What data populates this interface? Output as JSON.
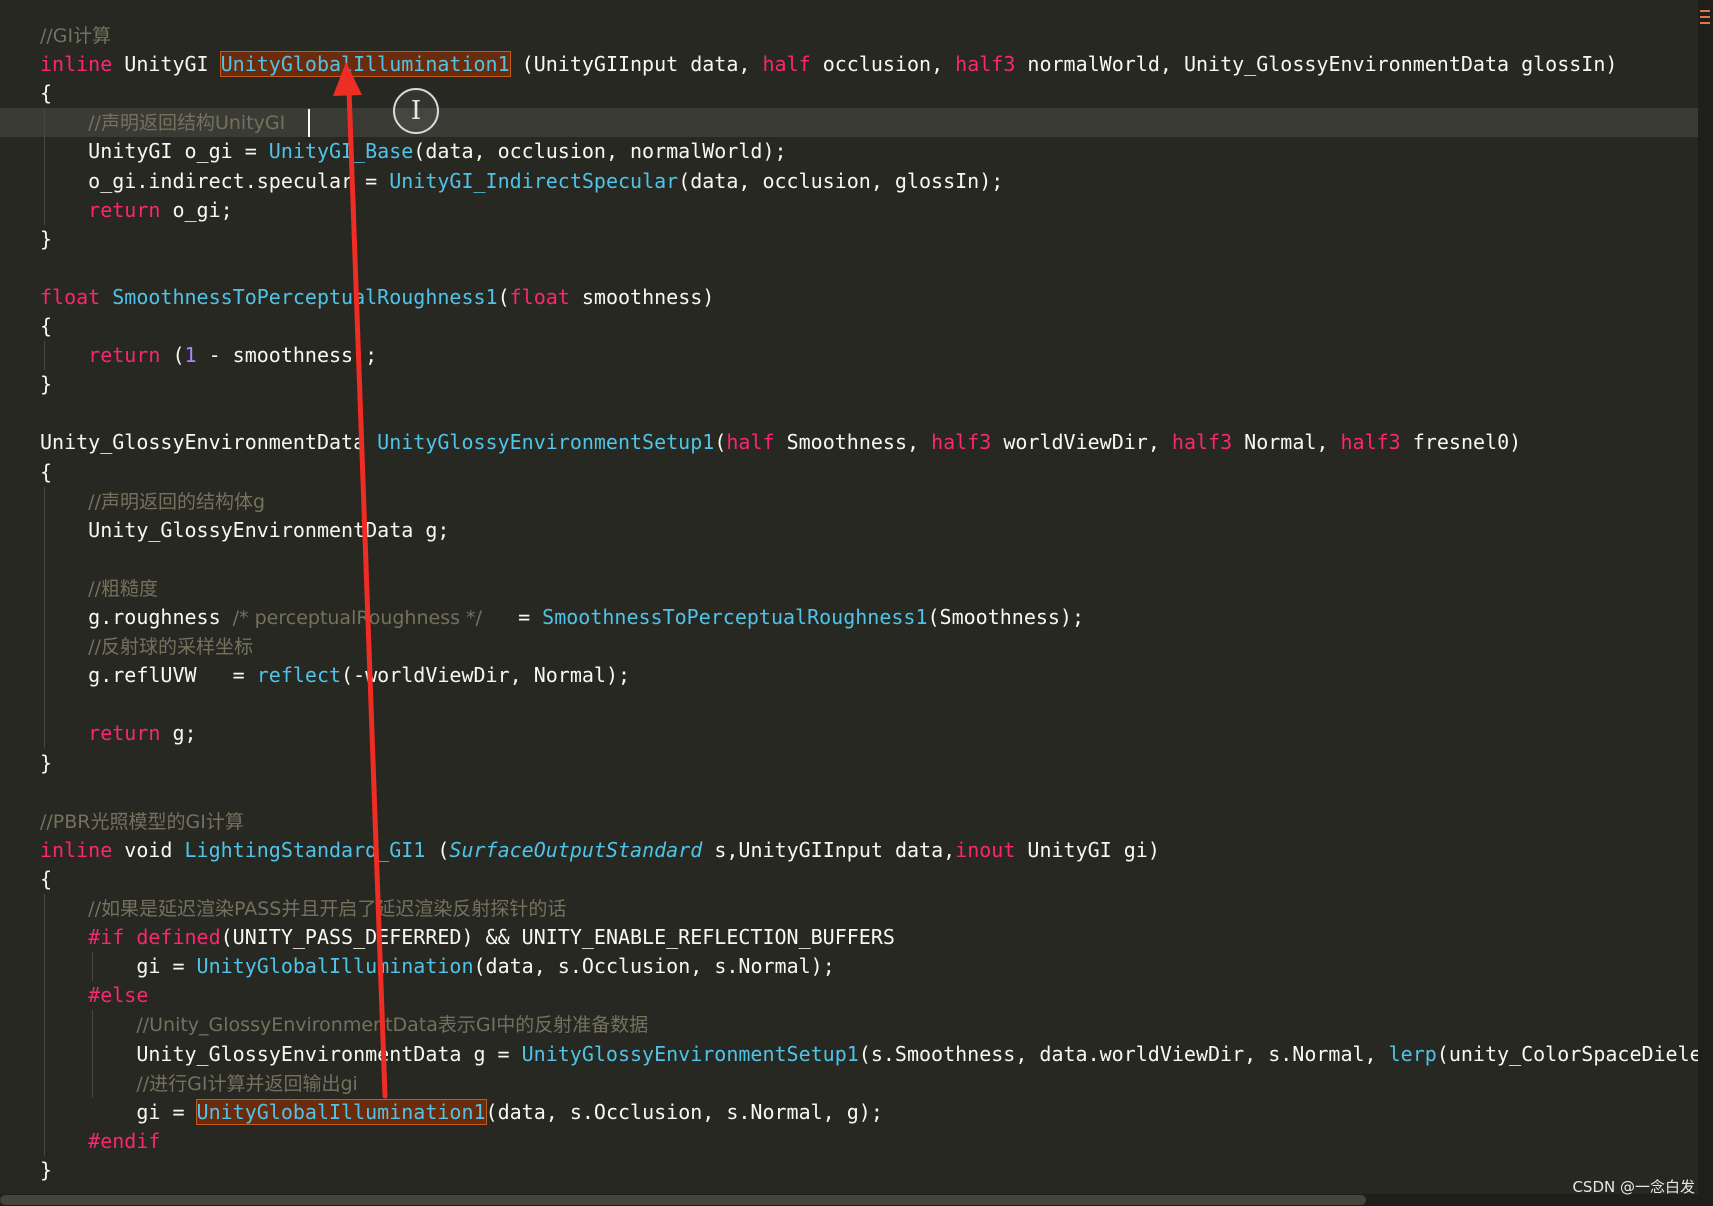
{
  "editor": {
    "lines": [
      [
        [
          "c",
          "//GI计算"
        ]
      ],
      [
        [
          "k",
          "inline"
        ],
        [
          "p",
          " UnityGI "
        ],
        [
          "h",
          "UnityGlobalIllumination1"
        ],
        [
          "p",
          " (UnityGIInput data, "
        ],
        [
          "k",
          "half"
        ],
        [
          "p",
          " occlusion, "
        ],
        [
          "k",
          "half3"
        ],
        [
          "p",
          " normalWorld, Unity_GlossyEnvironmentData glossIn)"
        ]
      ],
      [
        [
          "p",
          "{"
        ]
      ],
      [
        [
          "p",
          "    "
        ],
        [
          "c",
          "//声明返回结构UnityGI"
        ]
      ],
      [
        [
          "p",
          "    UnityGI o_gi = "
        ],
        [
          "f",
          "UnityGI_Base"
        ],
        [
          "p",
          "(data, occlusion, normalWorld);"
        ]
      ],
      [
        [
          "p",
          "    o_gi.indirect.specular = "
        ],
        [
          "f",
          "UnityGI_IndirectSpecular"
        ],
        [
          "p",
          "(data, occlusion, glossIn);"
        ]
      ],
      [
        [
          "p",
          "    "
        ],
        [
          "k",
          "return"
        ],
        [
          "p",
          " o_gi;"
        ]
      ],
      [
        [
          "p",
          "}"
        ]
      ],
      [],
      [
        [
          "k",
          "float"
        ],
        [
          "p",
          " "
        ],
        [
          "f",
          "SmoothnessToPerceptualRoughness1"
        ],
        [
          "p",
          "("
        ],
        [
          "k",
          "float"
        ],
        [
          "p",
          " smoothness)"
        ]
      ],
      [
        [
          "p",
          "{"
        ]
      ],
      [
        [
          "p",
          "    "
        ],
        [
          "k",
          "return"
        ],
        [
          "p",
          " ("
        ],
        [
          "n",
          "1"
        ],
        [
          "p",
          " - smoothness);"
        ]
      ],
      [
        [
          "p",
          "}"
        ]
      ],
      [],
      [
        [
          "p",
          "Unity_GlossyEnvironmentData "
        ],
        [
          "f",
          "UnityGlossyEnvironmentSetup1"
        ],
        [
          "p",
          "("
        ],
        [
          "k",
          "half"
        ],
        [
          "p",
          " Smoothness, "
        ],
        [
          "k",
          "half3"
        ],
        [
          "p",
          " worldViewDir, "
        ],
        [
          "k",
          "half3"
        ],
        [
          "p",
          " Normal, "
        ],
        [
          "k",
          "half3"
        ],
        [
          "p",
          " fresnel0)"
        ]
      ],
      [
        [
          "p",
          "{"
        ]
      ],
      [
        [
          "p",
          "    "
        ],
        [
          "c",
          "//声明返回的结构体g"
        ]
      ],
      [
        [
          "p",
          "    Unity_GlossyEnvironmentData g;"
        ]
      ],
      [],
      [
        [
          "p",
          "    "
        ],
        [
          "c",
          "//粗糙度"
        ]
      ],
      [
        [
          "p",
          "    g.roughness "
        ],
        [
          "c",
          "/* perceptualRoughness */"
        ],
        [
          "p",
          "   = "
        ],
        [
          "f",
          "SmoothnessToPerceptualRoughness1"
        ],
        [
          "p",
          "(Smoothness);"
        ]
      ],
      [
        [
          "p",
          "    "
        ],
        [
          "c",
          "//反射球的采样坐标"
        ]
      ],
      [
        [
          "p",
          "    g.reflUVW   = "
        ],
        [
          "f",
          "reflect"
        ],
        [
          "p",
          "(-worldViewDir, Normal);"
        ]
      ],
      [],
      [
        [
          "p",
          "    "
        ],
        [
          "k",
          "return"
        ],
        [
          "p",
          " g;"
        ]
      ],
      [
        [
          "p",
          "}"
        ]
      ],
      [],
      [
        [
          "c",
          "//PBR光照模型的GI计算"
        ]
      ],
      [
        [
          "k",
          "inline"
        ],
        [
          "p",
          " void "
        ],
        [
          "f",
          "LightingStandard_GI1"
        ],
        [
          "p",
          " ("
        ],
        [
          "i",
          "SurfaceOutputStandard"
        ],
        [
          "p",
          " s,UnityGIInput data,"
        ],
        [
          "k",
          "inout"
        ],
        [
          "p",
          " UnityGI gi)"
        ]
      ],
      [
        [
          "p",
          "{"
        ]
      ],
      [
        [
          "p",
          "    "
        ],
        [
          "c",
          "//如果是延迟渲染PASS并且开启了延迟渲染反射探针的话"
        ]
      ],
      [
        [
          "p",
          "    "
        ],
        [
          "k",
          "#if defined"
        ],
        [
          "p",
          "(UNITY_PASS_DEFERRED) && UNITY_ENABLE_REFLECTION_BUFFERS"
        ]
      ],
      [
        [
          "p",
          "        gi = "
        ],
        [
          "f",
          "UnityGlobalIllumination"
        ],
        [
          "p",
          "(data, s.Occlusion, s.Normal);"
        ]
      ],
      [
        [
          "p",
          "    "
        ],
        [
          "k",
          "#else"
        ]
      ],
      [
        [
          "p",
          "        "
        ],
        [
          "c",
          "//Unity_GlossyEnvironmentData表示GI中的反射准备数据"
        ]
      ],
      [
        [
          "p",
          "        Unity_GlossyEnvironmentData g = "
        ],
        [
          "f",
          "UnityGlossyEnvironmentSetup1"
        ],
        [
          "p",
          "(s.Smoothness, data.worldViewDir, s.Normal, "
        ],
        [
          "f",
          "lerp"
        ],
        [
          "p",
          "(unity_ColorSpaceDielectric"
        ]
      ],
      [
        [
          "p",
          "        "
        ],
        [
          "c",
          "//进行GI计算并返回输出gi"
        ]
      ],
      [
        [
          "p",
          "        gi = "
        ],
        [
          "h",
          "UnityGlobalIllumination1"
        ],
        [
          "p",
          "(data, s.Occlusion, s.Normal, g);"
        ]
      ],
      [
        [
          "p",
          "    "
        ],
        [
          "k",
          "#endif"
        ]
      ],
      [
        [
          "p",
          "}"
        ]
      ]
    ]
  },
  "watermark": "CSDN @一念白发",
  "colors": {
    "background": "#272822",
    "keyword": "#f92672",
    "function": "#4fc3e8",
    "comment": "#75715e",
    "text": "#f8f8f2",
    "number": "#ae81ff",
    "highlight": "#6a2c0c",
    "arrow": "#ee2d24"
  },
  "icons": {
    "cursor": "text-cursor-icon",
    "arrow": "red-arrow-annotation"
  }
}
